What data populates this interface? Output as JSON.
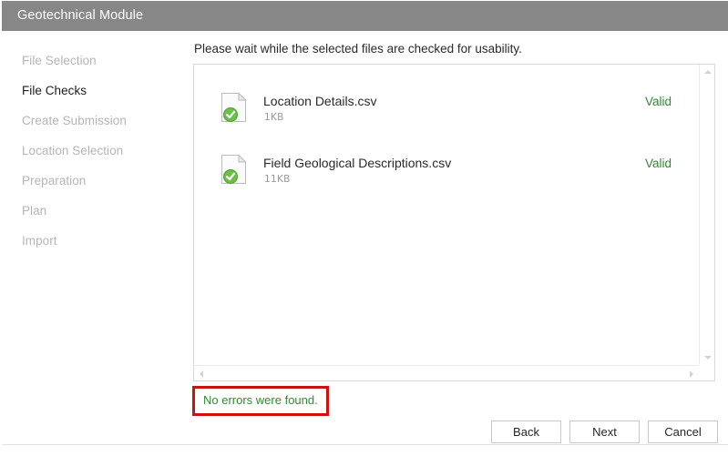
{
  "window": {
    "title": "Geotechnical Module",
    "titlebar_color": "#878787"
  },
  "sidebar": {
    "items": [
      {
        "label": "File Selection",
        "active": false
      },
      {
        "label": "File Checks",
        "active": true
      },
      {
        "label": "Create Submission",
        "active": false
      },
      {
        "label": "Location Selection",
        "active": false
      },
      {
        "label": "Preparation",
        "active": false
      },
      {
        "label": "Plan",
        "active": false
      },
      {
        "label": "Import",
        "active": false
      }
    ],
    "active_color": "#1c1c1c",
    "inactive_color": "#b5b5b5"
  },
  "main": {
    "instruction": "Please wait while the selected files are checked for usability.",
    "files": [
      {
        "name": "Location Details.csv",
        "size": "1KB",
        "status": "Valid",
        "icon": "file-check-icon"
      },
      {
        "name": "Field Geological Descriptions.csv",
        "size": "11KB",
        "status": "Valid",
        "icon": "file-check-icon"
      }
    ],
    "status_color": "#2f8a32"
  },
  "annotation": {
    "text": "No errors were found.",
    "text_color": "#2f8a32",
    "border_color": "#cc1111"
  },
  "footer": {
    "buttons": [
      {
        "label": "Back"
      },
      {
        "label": "Next"
      },
      {
        "label": "Cancel"
      }
    ]
  }
}
